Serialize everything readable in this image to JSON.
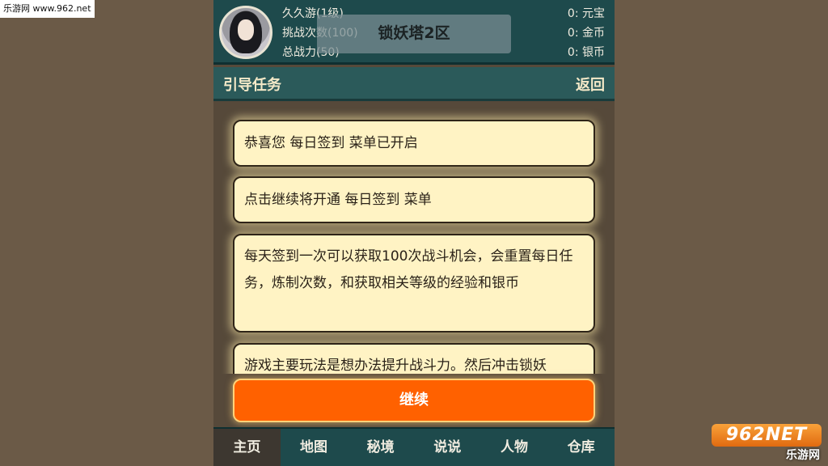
{
  "watermark": {
    "top_left": "乐游网 www.962.net",
    "badge": "962NET",
    "sub": "乐游网"
  },
  "header": {
    "player_name": "久久游(1级)",
    "challenge_count": "挑战次数(100)",
    "total_power": "总战力(50)",
    "server": "锁妖塔2区",
    "currencies": [
      {
        "label": "0: 元宝"
      },
      {
        "label": "0: 金币"
      },
      {
        "label": "0: 银币"
      }
    ]
  },
  "task_bar": {
    "title": "引导任务",
    "back_label": "返回"
  },
  "messages": [
    {
      "text": "恭喜您 每日签到 菜单已开启"
    },
    {
      "text": "点击继续将开通 每日签到 菜单"
    },
    {
      "text": "每天签到一次可以获取100次战斗机会，会重置每日任务，炼制次数，和获取相关等级的经验和银币"
    },
    {
      "text": "游戏主要玩法是想办法提升战斗力。然后冲击锁妖"
    }
  ],
  "continue_label": "继续",
  "nav": [
    {
      "label": "主页",
      "active": true
    },
    {
      "label": "地图"
    },
    {
      "label": "秘境"
    },
    {
      "label": "说说"
    },
    {
      "label": "人物"
    },
    {
      "label": "仓库"
    }
  ]
}
